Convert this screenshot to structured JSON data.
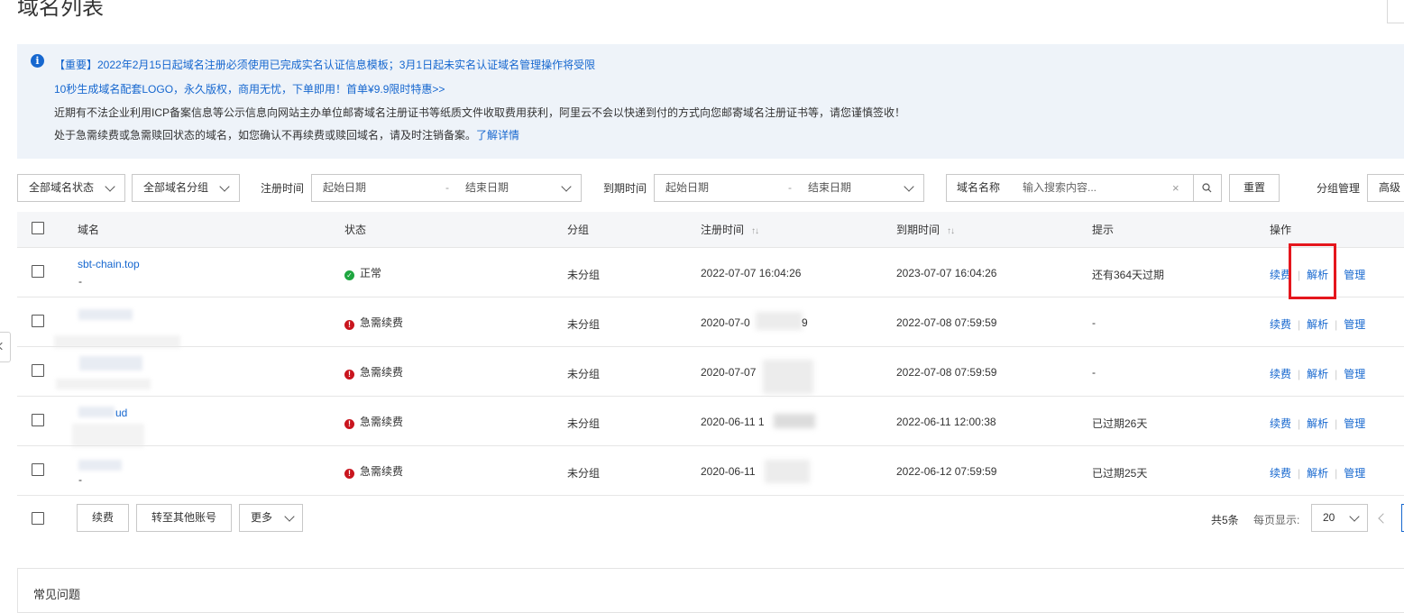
{
  "page": {
    "title": "域名列表"
  },
  "notice": {
    "line1": "【重要】2022年2月15日起域名注册必须使用已完成实名认证信息模板；3月1日起未实名认证域名管理操作将受限",
    "line2": "10秒生成域名配套LOGO，永久版权，商用无忧，下单即用！首单¥9.9限时特惠>>",
    "line3": "近期有不法企业利用ICP备案信息等公示信息向网站主办单位邮寄域名注册证书等纸质文件收取费用获利，阿里云不会以快递到付的方式向您邮寄域名注册证书等，请您谨慎签收！",
    "line4": "处于急需续费或急需赎回状态的域名，如您确认不再续费或赎回域名，请及时注销备案。",
    "line4_link": "了解详情"
  },
  "filters": {
    "status_select": "全部域名状态",
    "group_select": "全部域名分组",
    "reg_time_label": "注册时间",
    "exp_time_label": "到期时间",
    "start_placeholder": "起始日期",
    "end_placeholder": "结束日期",
    "dash": "-",
    "search_type": "域名名称",
    "search_placeholder": "输入搜索内容...",
    "reset_button": "重置",
    "group_manage": "分组管理",
    "advanced": "高级"
  },
  "table": {
    "headers": {
      "domain": "域名",
      "status": "状态",
      "group": "分组",
      "reg_time": "注册时间",
      "exp_time": "到期时间",
      "tip": "提示",
      "actions": "操作"
    },
    "action_labels": {
      "renew": "续费",
      "resolve": "解析",
      "manage": "管理"
    },
    "rows": [
      {
        "domain": "sbt-chain.top",
        "sub": "-",
        "status": "正常",
        "status_type": "ok",
        "group": "未分组",
        "reg": "2022-07-07 16:04:26",
        "exp": "2023-07-07 16:04:26",
        "tip": "还有364天过期"
      },
      {
        "domain": "",
        "sub": "",
        "status": "急需续费",
        "status_type": "warn",
        "group": "未分组",
        "reg": "2020-07-0",
        "reg_tail": "9",
        "exp": "2022-07-08 07:59:59",
        "tip": "-"
      },
      {
        "domain": "",
        "sub": "-",
        "status": "急需续费",
        "status_type": "warn",
        "group": "未分组",
        "reg": "2020-07-07",
        "exp": "2022-07-08 07:59:59",
        "tip": "-"
      },
      {
        "domain": "ud",
        "sub": "",
        "status": "急需续费",
        "status_type": "warn",
        "group": "未分组",
        "reg": "2020-06-11 1",
        "exp": "2022-06-11 12:00:38",
        "tip": "已过期26天"
      },
      {
        "domain": "",
        "sub": "-",
        "status": "急需续费",
        "status_type": "warn",
        "group": "未分组",
        "reg": "2020-06-11",
        "exp": "2022-06-12 07:59:59",
        "tip": "已过期25天"
      }
    ]
  },
  "footer": {
    "renew_button": "续费",
    "transfer_button": "转至其他账号",
    "more_select": "更多",
    "total": "共5条",
    "per_page_label": "每页显示:",
    "per_page_value": "20"
  },
  "faq": {
    "title": "常见问题"
  },
  "colors": {
    "link": "#1667cf",
    "highlight": "#e5161d",
    "ok": "#1fa640",
    "warn": "#c9151e"
  }
}
